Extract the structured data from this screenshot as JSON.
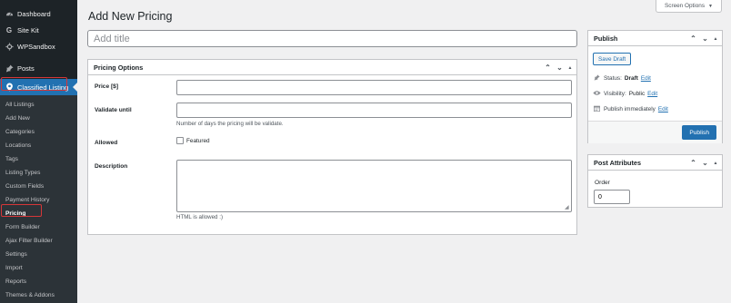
{
  "sidebar": {
    "top_items": [
      {
        "label": "Dashboard",
        "icon": "dashboard-icon"
      },
      {
        "label": "Site Kit",
        "icon": "site-kit-icon"
      },
      {
        "label": "WPSandbox",
        "icon": "wpsandbox-icon"
      },
      {
        "label": "Posts",
        "icon": "pin-icon"
      },
      {
        "label": "Classified Listing",
        "icon": "location-pin-icon"
      }
    ],
    "submenu": [
      "All Listings",
      "Add New",
      "Categories",
      "Locations",
      "Tags",
      "Listing Types",
      "Custom Fields",
      "Payment History",
      "Pricing",
      "Form Builder",
      "Ajax Filter Builder",
      "Settings",
      "Import",
      "Reports",
      "Themes & Addons"
    ]
  },
  "header": {
    "screen_options": "Screen Options",
    "page_title": "Add New Pricing",
    "title_placeholder": "Add title"
  },
  "pricing_options": {
    "title": "Pricing Options",
    "price_label": "Price [$]",
    "validate_label": "Validate until",
    "validate_hint": "Number of days the pricing will be validate.",
    "allowed_label": "Allowed",
    "featured_label": "Featured",
    "description_label": "Description",
    "description_hint": "HTML is allowed :)"
  },
  "publish": {
    "title": "Publish",
    "save_draft": "Save Draft",
    "status_label": "Status:",
    "status_value": "Draft",
    "visibility_label": "Visibility:",
    "visibility_value": "Public",
    "publish_time": "Publish immediately",
    "edit": "Edit",
    "publish_button": "Publish"
  },
  "post_attributes": {
    "title": "Post Attributes",
    "order_label": "Order",
    "order_value": "0"
  },
  "colors": {
    "sidebar_bg": "#1d2327",
    "submenu_bg": "#2c3338",
    "accent": "#2271b1",
    "highlight": "#d63638"
  }
}
